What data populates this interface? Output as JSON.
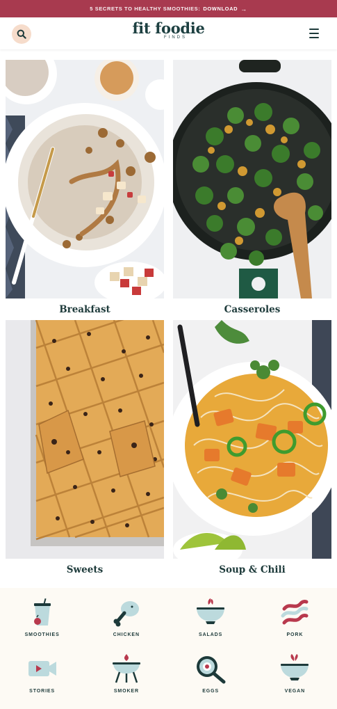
{
  "banner": {
    "lead": "5 SECRETS TO HEALTHY SMOOTHIES:",
    "cta": "DOWNLOAD",
    "arrow": "→"
  },
  "header": {
    "logo_main": "fit foodie",
    "logo_sub": "FINDS",
    "search_icon": "search-icon",
    "menu_icon": "hamburger-menu-icon"
  },
  "categories": [
    {
      "label": "Breakfast",
      "image": "oatmeal-bowl-with-apples"
    },
    {
      "label": "Casseroles",
      "image": "broccoli-cheddar-skillet"
    },
    {
      "label": "Sweets",
      "image": "chocolate-chip-sheet-pan-bars"
    },
    {
      "label": "Soup & Chili",
      "image": "curry-noodle-soup"
    }
  ],
  "icon_links": [
    {
      "label": "SMOOTHIES",
      "icon": "smoothie-icon"
    },
    {
      "label": "CHICKEN",
      "icon": "chicken-leg-icon"
    },
    {
      "label": "SALADS",
      "icon": "salad-bowl-icon"
    },
    {
      "label": "PORK",
      "icon": "bacon-icon"
    },
    {
      "label": "STORIES",
      "icon": "video-camera-icon"
    },
    {
      "label": "SMOKER",
      "icon": "grill-icon"
    },
    {
      "label": "EGGS",
      "icon": "frying-pan-egg-icon"
    },
    {
      "label": "VEGAN",
      "icon": "vegan-bowl-icon"
    }
  ],
  "colors": {
    "banner": "#a83a4f",
    "brand_dark": "#1d4041",
    "search_bg": "#f6dccb",
    "icon_teal": "#bcdadd",
    "icon_red": "#b8394d",
    "icon_dark": "#1d3a3a"
  }
}
